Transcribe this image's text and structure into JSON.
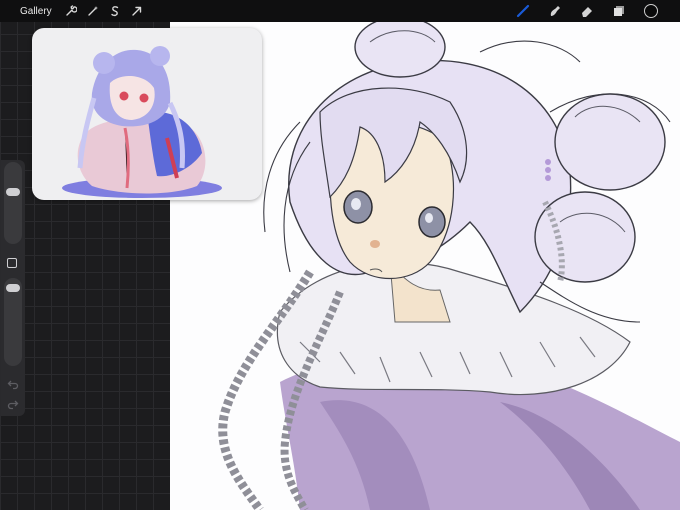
{
  "topbar": {
    "gallery_label": "Gallery",
    "left_tools": [
      "wrench-icon",
      "magic-wand-icon",
      "selection-s-icon",
      "arrow-transform-icon"
    ],
    "right_tools": [
      "brush-icon",
      "smudge-icon",
      "eraser-icon",
      "layers-icon",
      "color-swatch-icon"
    ],
    "active_tool": "brush-icon",
    "active_color": "#1a5bd8",
    "current_color": "#0a0a0a"
  },
  "sidebar": {
    "size_slider_level": 0.12,
    "opacity_slider_level": 0.05,
    "controls": [
      "modify-button",
      "undo-button",
      "redo-button"
    ]
  },
  "reference_window": {
    "description_icon": "reference-image"
  },
  "colors": {
    "interface_bg": "#1c1c1e",
    "topbar": "#0f0f10",
    "canvas": "#fdfdfe",
    "hair": "#e6e0f3",
    "coat": "#b8a3cc"
  }
}
